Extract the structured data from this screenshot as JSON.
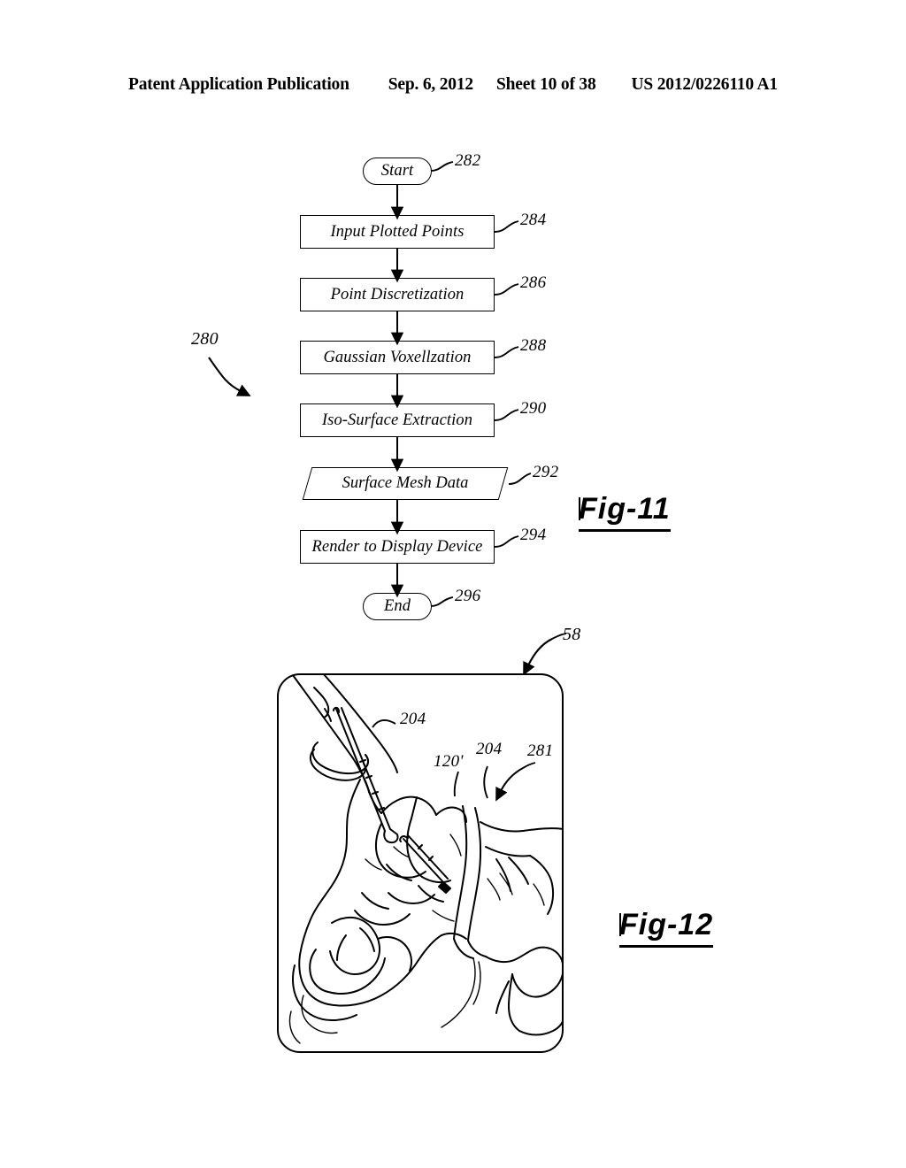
{
  "header": {
    "publication": "Patent Application Publication",
    "date": "Sep. 6, 2012",
    "sheet": "Sheet 10 of 38",
    "patent_number": "US 2012/0226110 A1"
  },
  "figures": [
    {
      "id": "fig-11",
      "caption": "Fig-11",
      "overall_ref": "280",
      "type": "flowchart",
      "nodes": [
        {
          "ref": "282",
          "label": "Start",
          "shape": "terminator"
        },
        {
          "ref": "284",
          "label": "Input Plotted Points",
          "shape": "process"
        },
        {
          "ref": "286",
          "label": "Point Discretization",
          "shape": "process"
        },
        {
          "ref": "288",
          "label": "Gaussian Voxellzation",
          "shape": "process"
        },
        {
          "ref": "290",
          "label": "Iso-Surface Extraction",
          "shape": "process"
        },
        {
          "ref": "292",
          "label": "Surface Mesh Data",
          "shape": "data"
        },
        {
          "ref": "294",
          "label": "Render to Display Device",
          "shape": "process"
        },
        {
          "ref": "296",
          "label": "End",
          "shape": "terminator"
        }
      ]
    },
    {
      "id": "fig-12",
      "caption": "Fig-12",
      "overall_ref": "58",
      "type": "illustration",
      "callouts": [
        {
          "ref": "204",
          "kind": "leader"
        },
        {
          "ref": "120'",
          "kind": "leader"
        },
        {
          "ref": "204",
          "kind": "leader"
        },
        {
          "ref": "281",
          "kind": "arrow"
        }
      ]
    }
  ],
  "colors": {
    "ink": "#000000",
    "paper": "#ffffff"
  }
}
